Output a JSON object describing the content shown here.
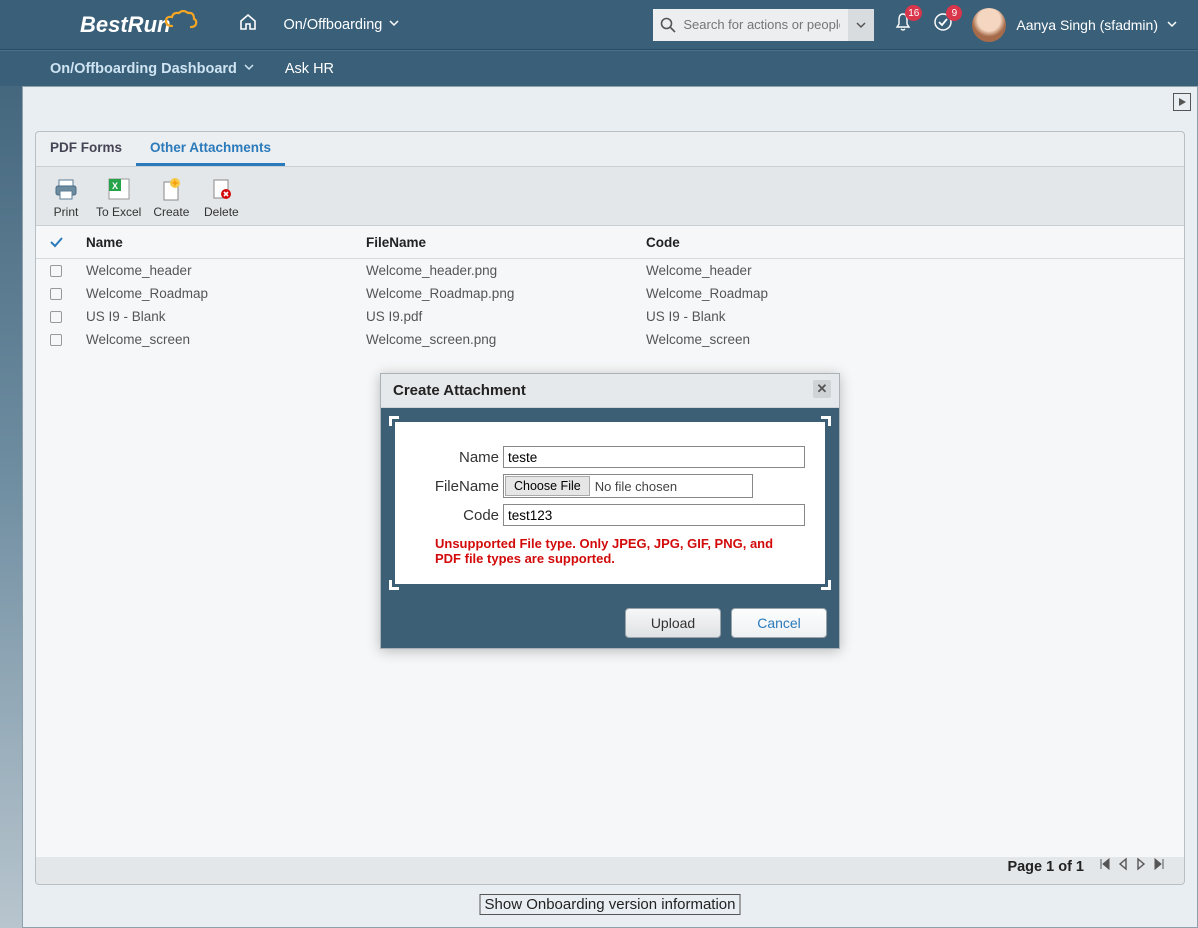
{
  "header": {
    "logo_text": "BestRun",
    "nav_module": "On/Offboarding",
    "search_placeholder": "Search for actions or people",
    "badge_bell": "16",
    "badge_check": "9",
    "user_display": "Aanya Singh (sfadmin)"
  },
  "subnav": {
    "item1": "On/Offboarding Dashboard",
    "item2": "Ask HR"
  },
  "tabs": {
    "pdf_forms": "PDF Forms",
    "other_attachments": "Other Attachments"
  },
  "toolbar": {
    "print": "Print",
    "to_excel": "To Excel",
    "create": "Create",
    "delete": "Delete"
  },
  "columns": {
    "name": "Name",
    "filename": "FileName",
    "code": "Code"
  },
  "rows": [
    {
      "name": "Welcome_header",
      "filename": "Welcome_header.png",
      "code": "Welcome_header"
    },
    {
      "name": "Welcome_Roadmap",
      "filename": "Welcome_Roadmap.png",
      "code": "Welcome_Roadmap"
    },
    {
      "name": "US I9 - Blank",
      "filename": "US I9.pdf",
      "code": "US I9 - Blank"
    },
    {
      "name": "Welcome_screen",
      "filename": "Welcome_screen.png",
      "code": "Welcome_screen"
    }
  ],
  "modal": {
    "title": "Create Attachment",
    "labels": {
      "name": "Name",
      "filename": "FileName",
      "code": "Code"
    },
    "values": {
      "name": "teste",
      "code": "test123"
    },
    "file_button": "Choose File",
    "file_status": "No file chosen",
    "error": "Unsupported File type. Only JPEG, JPG, GIF, PNG, and PDF file types are supported.",
    "upload": "Upload",
    "cancel": "Cancel"
  },
  "footer": {
    "page_text": "Page 1 of 1"
  },
  "bottom_link": "Show Onboarding version information"
}
